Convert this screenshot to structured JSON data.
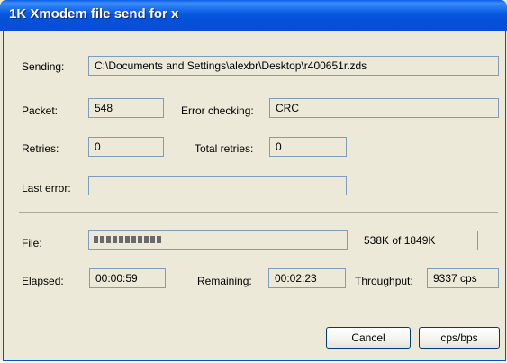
{
  "window": {
    "title": "1K Xmodem file send for x"
  },
  "sending": {
    "label": "Sending:",
    "value": "C:\\Documents and Settings\\alexbr\\Desktop\\r400651r.zds"
  },
  "packet": {
    "label": "Packet:",
    "value": "548"
  },
  "error_checking": {
    "label": "Error checking:",
    "value": "CRC"
  },
  "retries": {
    "label": "Retries:",
    "value": "0"
  },
  "total_retries": {
    "label": "Total retries:",
    "value": "0"
  },
  "last_error": {
    "label": "Last error:",
    "value": ""
  },
  "file": {
    "label": "File:",
    "progress_fraction": 0.291,
    "size_text": "538K of 1849K"
  },
  "elapsed": {
    "label": "Elapsed:",
    "value": "00:00:59"
  },
  "remaining": {
    "label": "Remaining:",
    "value": "00:02:23"
  },
  "throughput": {
    "label": "Throughput:",
    "value": "9337 cps"
  },
  "buttons": {
    "cancel": "Cancel",
    "cps_bps": "cps/bps"
  },
  "colors": {
    "title_bar": "#0a5ce6",
    "dialog_bg": "#ece9d8",
    "field_border": "#7f9db9",
    "progress_segment": "#6a6a6a"
  }
}
